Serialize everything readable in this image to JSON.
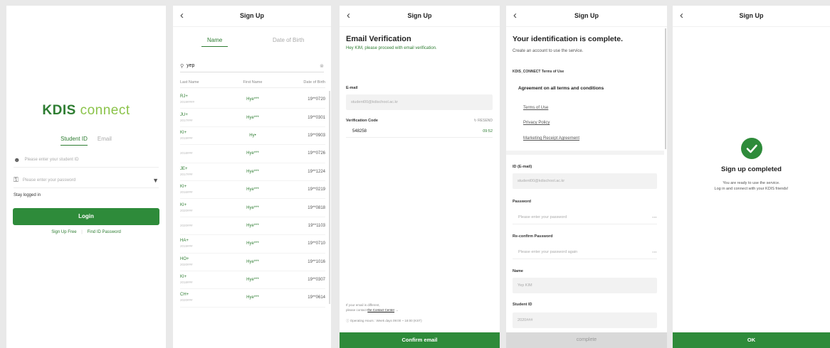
{
  "login": {
    "logo_part1": "KDIS",
    "logo_part2": "connect",
    "tab_student_id": "Student ID",
    "tab_email": "Email",
    "student_id_placeholder": "Please enter your student ID",
    "password_placeholder": "Please enter your password",
    "stay_logged_in": "Stay logged in",
    "login_button": "Login",
    "sign_up_link": "Sign Up Free",
    "find_password_link": "Find ID Password",
    "link_separator": "|"
  },
  "search": {
    "title": "Sign Up",
    "tab_name": "Name",
    "tab_dob": "Date of Birth",
    "query": "yep",
    "columns": [
      "Last Name",
      "First Name",
      "Date of Birth"
    ],
    "rows": [
      {
        "last": "RJ+",
        "sub": "2019####",
        "first": "Hye***",
        "dob": "19**0720"
      },
      {
        "last": "JU+",
        "sub": "2017###",
        "first": "Hye***",
        "dob": "19**0301"
      },
      {
        "last": "KI+",
        "sub": "2019###",
        "first": "Hy•",
        "dob": "19**0903"
      },
      {
        "last": "",
        "sub": "2018###",
        "first": "Hye***",
        "dob": "19**0726"
      },
      {
        "last": "JE+",
        "sub": "2017###",
        "first": "Hye***",
        "dob": "19**1224"
      },
      {
        "last": "KI+",
        "sub": "2016###",
        "first": "Hye***",
        "dob": "19**0219"
      },
      {
        "last": "KI+",
        "sub": "2020###",
        "first": "Hye***",
        "dob": "19**0818"
      },
      {
        "last": "",
        "sub": "2020###",
        "first": "Hye***",
        "dob": "19**1103"
      },
      {
        "last": "HA+",
        "sub": "2019###",
        "first": "Hye***",
        "dob": "19**0710"
      },
      {
        "last": "HO+",
        "sub": "2020###",
        "first": "Hye***",
        "dob": "19**1016"
      },
      {
        "last": "KI+",
        "sub": "2018###",
        "first": "Hye***",
        "dob": "19**0307"
      },
      {
        "last": "CH+",
        "sub": "2020###",
        "first": "Hye***",
        "dob": "19**0614"
      }
    ]
  },
  "verify": {
    "title": "Sign Up",
    "heading": "Email Verification",
    "subheading": "Hey KIM, please proceed with email verification.",
    "email_label": "E-mail",
    "email_value": "student00@kdischool.ac.kr",
    "code_label": "Verification Code",
    "resend": "↻ RESEND",
    "code_value": "548258",
    "timer": "09:52",
    "help_text": "If your email is different,",
    "help_text2": "please contact",
    "help_link": "the Contact Center",
    "help_arrow": "→",
    "hours": "ⓘ Operating Hours : Week days 09:00 ~ 18:00 (KST)",
    "button": "Confirm email"
  },
  "account": {
    "title": "Sign Up",
    "heading": "Your identification is complete.",
    "subheading": "Create an account to use the service.",
    "terms_title": "KDIS_CONNECT Terms of Use",
    "agree_all": "Agreement on all terms and conditions",
    "terms_links": [
      "Terms of Use",
      "Privacy Policy",
      "Marketing Receipt Agreement"
    ],
    "id_label": "ID (E-mail)",
    "id_value": "student00@kdischool.ac.kr",
    "password_label": "Password",
    "password_placeholder": "Please enter your password",
    "reconfirm_label": "Re-confirm Password",
    "reconfirm_placeholder": "Please enter your password again",
    "name_label": "Name",
    "name_value": "Yep KIM",
    "student_id_label": "Student ID",
    "student_id_value": "2020###",
    "button": "complete"
  },
  "complete": {
    "title": "Sign Up",
    "heading": "Sign up completed",
    "line1": "You are ready to use the service.",
    "line2": "Log in and connect with your KDIS friends!",
    "button": "OK"
  },
  "colors": {
    "brand_green": "#2e8b3a",
    "light_green": "#8bc34a"
  }
}
